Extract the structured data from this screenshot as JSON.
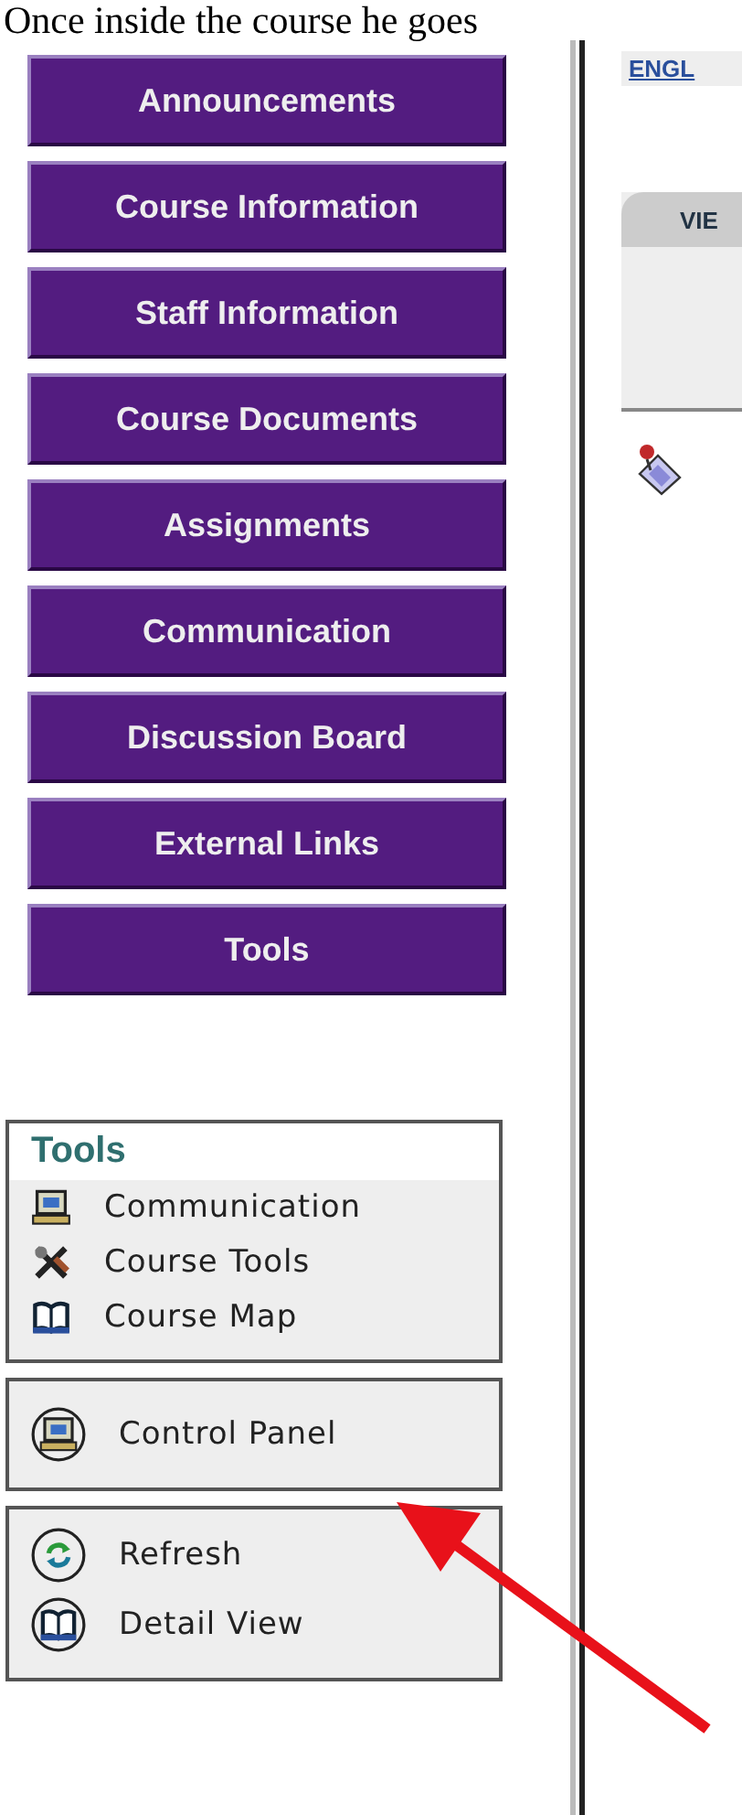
{
  "caption": "Once inside the course he goes",
  "nav_buttons": [
    "Announcements",
    "Course Information",
    "Staff Information",
    "Course Documents",
    "Assignments",
    "Communication",
    "Discussion Board",
    "External Links",
    "Tools"
  ],
  "tools_panel": {
    "title": "Tools",
    "items": [
      "Communication",
      "Course Tools",
      "Course Map"
    ]
  },
  "control_panel": {
    "label": "Control Panel"
  },
  "view_panel": {
    "items": [
      "Refresh",
      "Detail View"
    ]
  },
  "content": {
    "link": "ENGL",
    "tab": "VIE"
  }
}
